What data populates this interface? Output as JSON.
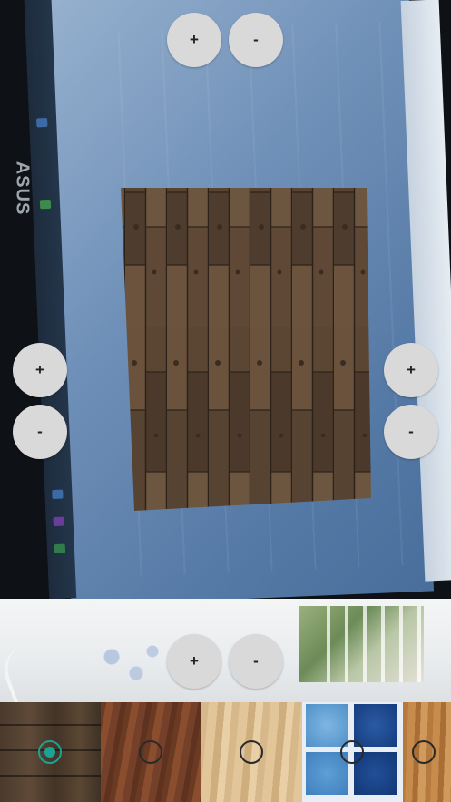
{
  "app": {
    "scene": "wood-texture-ar-preview"
  },
  "controls": {
    "top_plus": "+",
    "top_minus": "-",
    "left_plus": "+",
    "left_minus": "-",
    "right_plus": "+",
    "right_minus": "-",
    "bottom_plus": "+",
    "bottom_minus": "-"
  },
  "materials": {
    "selected_index": 0,
    "items": [
      {
        "name": "dark-weathered-wood",
        "selected": true
      },
      {
        "name": "red-brown-wood",
        "selected": false
      },
      {
        "name": "light-maple-wood",
        "selected": false
      },
      {
        "name": "blue-mosaic-tile",
        "selected": false
      },
      {
        "name": "golden-oak-wood",
        "selected": false
      }
    ]
  },
  "colors": {
    "selected_accent": "#1aa394",
    "button_bg": "#d9d9d9"
  }
}
